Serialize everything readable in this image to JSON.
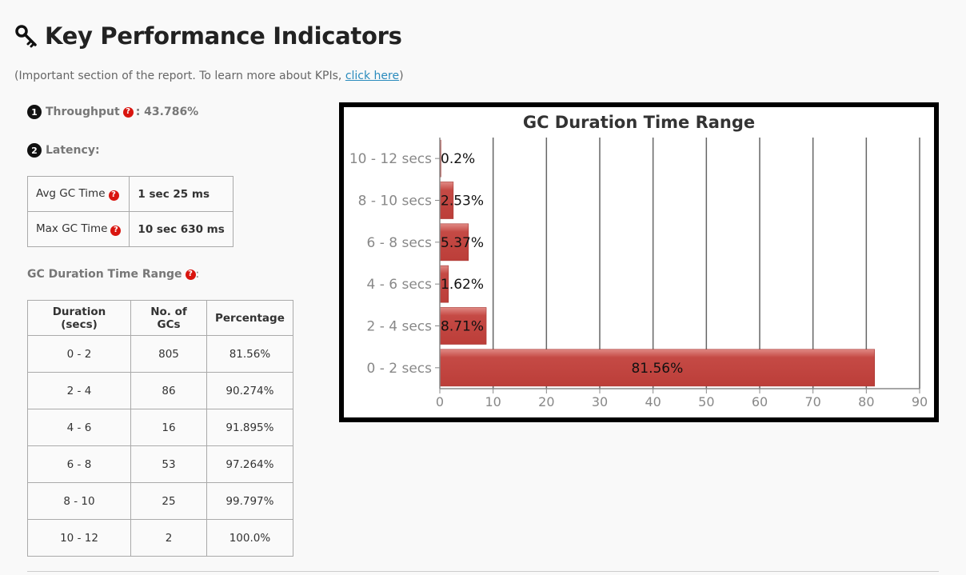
{
  "header": {
    "title": "Key Performance Indicators",
    "subtitle_prefix": "(Important section of the report. To learn more about KPIs, ",
    "subtitle_link": "click here",
    "subtitle_suffix": ")"
  },
  "throughput": {
    "badge": "1",
    "label": "Throughput",
    "value": ": 43.786%"
  },
  "latency": {
    "badge": "2",
    "label": "Latency:",
    "rows": [
      {
        "label": "Avg GC Time",
        "value": "1 sec 25 ms"
      },
      {
        "label": "Max GC Time",
        "value": "10 sec 630 ms"
      }
    ]
  },
  "gc_range": {
    "label": "GC Duration Time Range",
    "label_suffix": ":",
    "headers": [
      "Duration (secs)",
      "No. of GCs",
      "Percentage"
    ],
    "rows": [
      [
        "0 - 2",
        "805",
        "81.56%"
      ],
      [
        "2 - 4",
        "86",
        "90.274%"
      ],
      [
        "4 - 6",
        "16",
        "91.895%"
      ],
      [
        "6 - 8",
        "53",
        "97.264%"
      ],
      [
        "8 - 10",
        "25",
        "99.797%"
      ],
      [
        "10 - 12",
        "2",
        "100.0%"
      ]
    ]
  },
  "help_icon_glyph": "?",
  "colors": {
    "bar": "#c0443f",
    "help_icon": "#d9150f",
    "link": "#2a8bbd"
  },
  "chart_data": {
    "type": "bar",
    "orientation": "horizontal",
    "title": "GC Duration Time Range",
    "categories": [
      "0 - 2 secs",
      "2 - 4 secs",
      "4 - 6 secs",
      "6 - 8 secs",
      "8 - 10 secs",
      "10 - 12 secs"
    ],
    "values": [
      81.56,
      8.71,
      1.62,
      5.37,
      2.53,
      0.2
    ],
    "labels": [
      "81.56%",
      "8.71%",
      "1.62%",
      "5.37%",
      "2.53%",
      "0.2%"
    ],
    "xlim": [
      0,
      90
    ],
    "xticks": [
      0,
      10,
      20,
      30,
      40,
      50,
      60,
      70,
      80,
      90
    ],
    "grid": true
  }
}
